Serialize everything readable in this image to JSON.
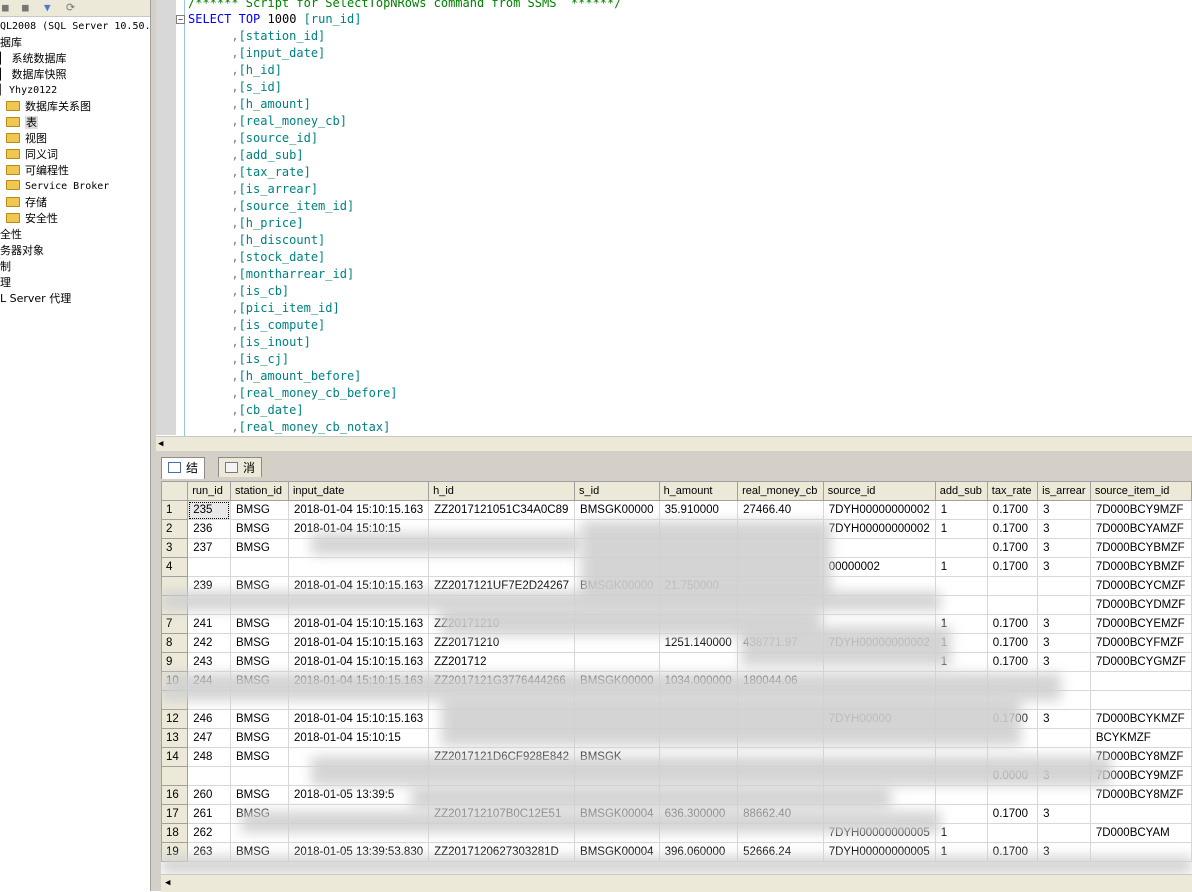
{
  "explorer": {
    "server_label": "QL2008 (SQL Server 10.50.",
    "items": [
      {
        "label": "据库",
        "indent": 0,
        "folder": false
      },
      {
        "label": "系统数据库",
        "indent": 1,
        "folder": false
      },
      {
        "label": "数据库快照",
        "indent": 1,
        "folder": false
      },
      {
        "label": "Yhyz0122",
        "indent": 1,
        "folder": false,
        "mono": true
      },
      {
        "label": "数据库关系图",
        "indent": 2,
        "folder": true
      },
      {
        "label": "表",
        "indent": 2,
        "folder": true,
        "selected": true
      },
      {
        "label": "视图",
        "indent": 2,
        "folder": true
      },
      {
        "label": "同义词",
        "indent": 2,
        "folder": true
      },
      {
        "label": "可编程性",
        "indent": 2,
        "folder": true
      },
      {
        "label": "Service Broker",
        "indent": 2,
        "folder": true,
        "mono": true
      },
      {
        "label": "存储",
        "indent": 2,
        "folder": true
      },
      {
        "label": "安全性",
        "indent": 2,
        "folder": true
      },
      {
        "label": "全性",
        "indent": 0,
        "folder": false
      },
      {
        "label": "务器对象",
        "indent": 0,
        "folder": false
      },
      {
        "label": "制",
        "indent": 0,
        "folder": false
      },
      {
        "label": "理",
        "indent": 0,
        "folder": false
      },
      {
        "label": "L Server 代理",
        "indent": 0,
        "folder": false
      }
    ]
  },
  "editor": {
    "comment": "/****** Script for SelectTopNRows command from SSMS  ******/",
    "select_kw": "SELECT",
    "top_kw": "TOP",
    "top_n": "1000",
    "first_col": "[run_id]",
    "columns": [
      "[station_id]",
      "[input_date]",
      "[h_id]",
      "[s_id]",
      "[h_amount]",
      "[real_money_cb]",
      "[source_id]",
      "[add_sub]",
      "[tax_rate]",
      "[is_arrear]",
      "[source_item_id]",
      "[h_price]",
      "[h_discount]",
      "[stock_date]",
      "[montharrear_id]",
      "[is_cb]",
      "[pici_item_id]",
      "[is_compute]",
      "[is_inout]",
      "[is_cj]",
      "[h_amount_before]",
      "[real_money_cb_before]",
      "[cb_date]",
      "[real_money_cb_notax]"
    ]
  },
  "results": {
    "tabs": [
      {
        "label": "结果",
        "active": true
      },
      {
        "label": "消息",
        "active": false
      }
    ],
    "headers": [
      "run_id",
      "station_id",
      "input_date",
      "h_id",
      "s_id",
      "h_amount",
      "real_money_cb",
      "source_id",
      "add_sub",
      "tax_rate",
      "is_arrear",
      "source_item_id"
    ],
    "rows": [
      [
        "1",
        "235",
        "BMSG",
        "2018-01-04 15:10:15.163",
        "ZZ2017121051C34A0C89",
        "BMSGK00000",
        "35.910000",
        "27466.40",
        "7DYH00000000002",
        "1",
        "0.1700",
        "3",
        "7D000BCY9MZF"
      ],
      [
        "2",
        "236",
        "BMSG",
        "2018-01-04 15:10:15",
        "",
        "",
        "",
        "",
        "7DYH00000000002",
        "1",
        "0.1700",
        "3",
        "7D000BCYAMZF"
      ],
      [
        "3",
        "237",
        "BMSG",
        "",
        "",
        "",
        "",
        "",
        "",
        "",
        "0.1700",
        "3",
        "7D000BCYBMZF"
      ],
      [
        "4",
        "",
        "",
        "",
        "",
        "",
        "",
        "",
        "00000002",
        "1",
        "0.1700",
        "3",
        "7D000BCYBMZF"
      ],
      [
        "",
        "239",
        "BMSG",
        "2018-01-04 15:10:15.163",
        "ZZ2017121UF7E2D24267",
        "BMSGK00000",
        "21.750000",
        "",
        "",
        "",
        "",
        "",
        "7D000BCYCMZF"
      ],
      [
        "",
        "",
        "",
        "",
        "",
        "",
        "",
        "",
        "",
        "",
        "",
        "",
        "7D000BCYDMZF"
      ],
      [
        "7",
        "241",
        "BMSG",
        "2018-01-04 15:10:15.163",
        "ZZ20171210",
        "",
        "",
        "",
        "",
        "1",
        "0.1700",
        "3",
        "7D000BCYEMZF"
      ],
      [
        "8",
        "242",
        "BMSG",
        "2018-01-04 15:10:15.163",
        "ZZ20171210",
        "",
        "1251.140000",
        "438771.97",
        "7DYH00000000002",
        "1",
        "0.1700",
        "3",
        "7D000BCYFMZF"
      ],
      [
        "9",
        "243",
        "BMSG",
        "2018-01-04 15:10:15.163",
        "ZZ201712",
        "",
        "",
        "",
        "",
        "1",
        "0.1700",
        "3",
        "7D000BCYGMZF"
      ],
      [
        "10",
        "244",
        "BMSG",
        "2018-01-04 15:10:15.163",
        "ZZ2017121G3776444266",
        "BMSGK00000",
        "1034.000000",
        "180044.06",
        "",
        "",
        "",
        "",
        ""
      ],
      [
        "",
        "",
        "",
        "",
        "",
        "",
        "",
        "",
        "",
        "",
        "",
        "",
        ""
      ],
      [
        "12",
        "246",
        "BMSG",
        "2018-01-04 15:10:15.163",
        "",
        "",
        "",
        "",
        "7DYH00000",
        "",
        "0.1700",
        "3",
        "7D000BCYKMZF"
      ],
      [
        "13",
        "247",
        "BMSG",
        "2018-01-04 15:10:15",
        "",
        "",
        "",
        "",
        "",
        "",
        "",
        "",
        "BCYKMZF"
      ],
      [
        "14",
        "248",
        "BMSG",
        "",
        "ZZ2017121D6CF928E842",
        "BMSGK",
        "",
        "",
        "",
        "",
        "",
        "",
        "7D000BCY8MZF"
      ],
      [
        "",
        "",
        "",
        "",
        "",
        "",
        "",
        "",
        "",
        "",
        "0.0000",
        "3",
        "7D000BCY9MZF"
      ],
      [
        "16",
        "260",
        "BMSG",
        "2018-01-05 13:39:5",
        "",
        "",
        "",
        "",
        "",
        "",
        "",
        "",
        "7D000BCY8MZF"
      ],
      [
        "17",
        "261",
        "BMSG",
        "",
        "ZZ201712107B0C12E51",
        "BMSGK00004",
        "636.300000",
        "88662.40",
        "",
        "",
        "0.1700",
        "3",
        ""
      ],
      [
        "18",
        "262",
        "",
        "",
        "",
        "",
        "",
        "",
        "7DYH00000000005",
        "1",
        "",
        "",
        "7D000BCYAM"
      ],
      [
        "19",
        "263",
        "BMSG",
        "2018-01-05 13:39:53.830",
        "ZZ2017120627303281D",
        "BMSGK00004",
        "396.060000",
        "52666.24",
        "7DYH00000000005",
        "1",
        "0.1700",
        "3",
        ""
      ]
    ]
  }
}
